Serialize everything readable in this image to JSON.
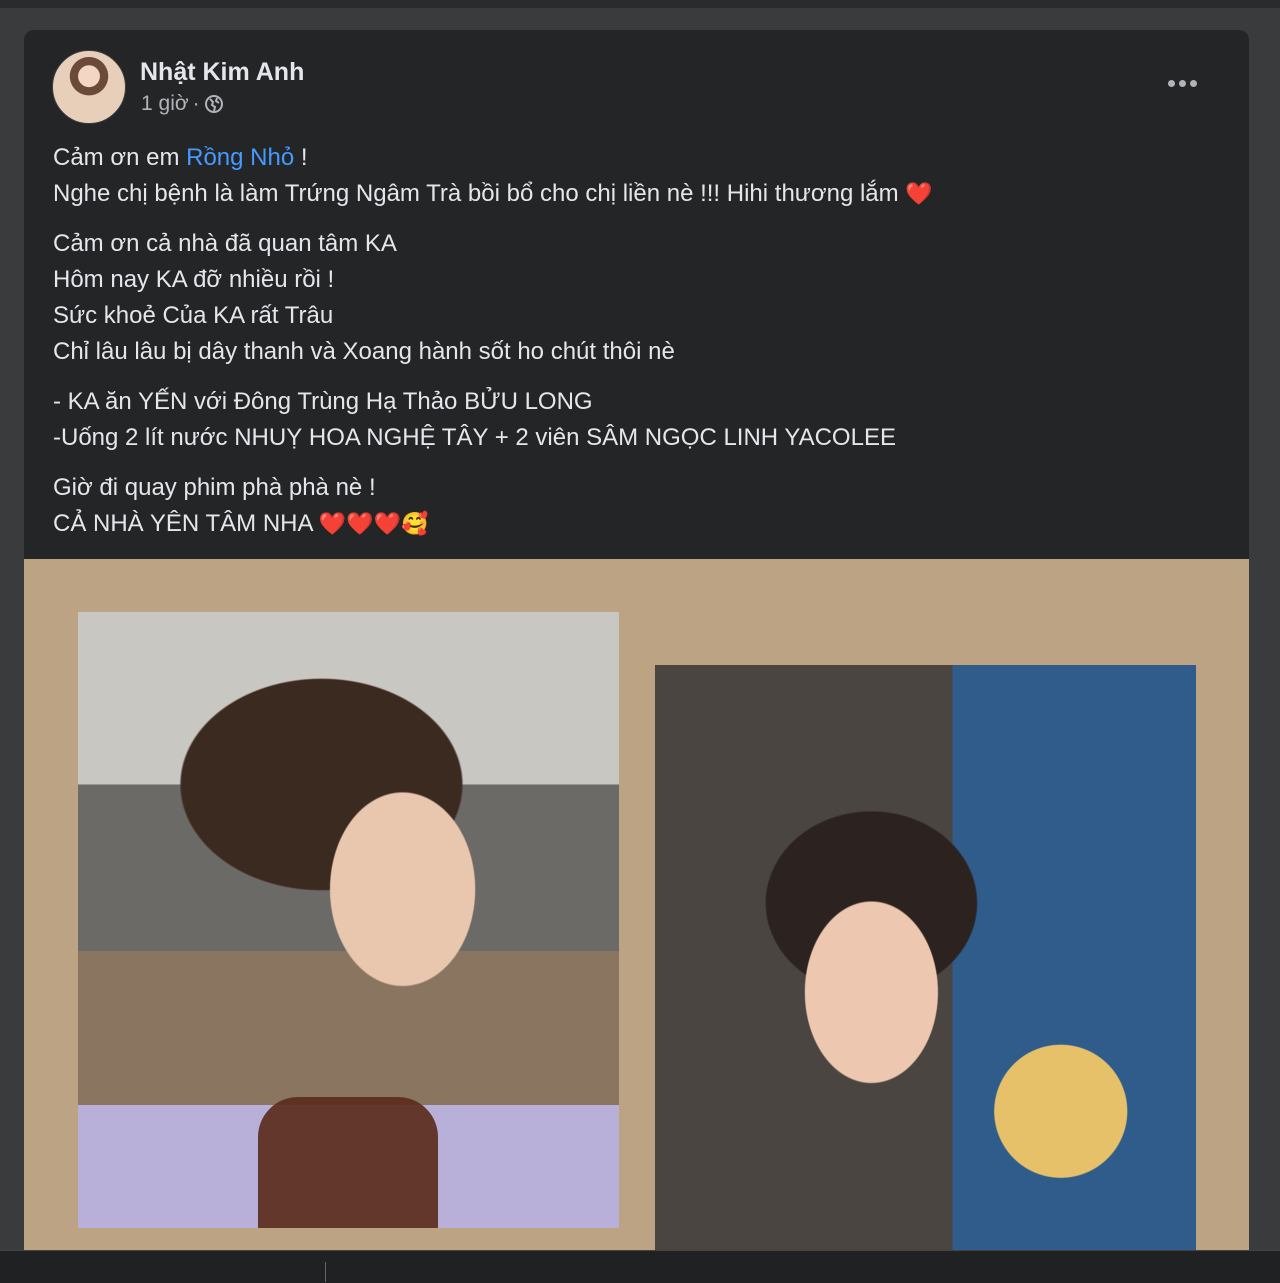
{
  "post": {
    "author": "Nhật Kim Anh",
    "time": "1 giờ",
    "separator": "·",
    "privacy_icon": "globe-icon",
    "more_icon": "more-dots-icon",
    "paragraphs": [
      {
        "lines": [
          {
            "before": "Cảm ơn em ",
            "mention": "Rồng Nhỏ",
            "after": " !"
          },
          {
            "before": "Nghe chị bệnh là làm Trứng Ngâm Trà bồi bổ cho chị liền nè  !!! Hihi thương lắm ",
            "emoji": "❤️"
          }
        ]
      },
      {
        "lines": [
          {
            "before": "Cảm ơn cả nhà đã quan tâm KA"
          },
          {
            "before": "Hôm nay KA đỡ nhiều rồi !"
          },
          {
            "before": "Sức khoẻ Của KA rất Trâu"
          },
          {
            "before": "Chỉ lâu lâu bị dây thanh và Xoang hành sốt ho chút thôi nè"
          }
        ]
      },
      {
        "lines": [
          {
            "before": "- KA ăn YẾN với Đông Trùng Hạ Thảo BỬU LONG"
          },
          {
            "before": "-Uống 2 lít nước NHUỴ HOA NGHỆ TÂY + 2 viên SÂM NGỌC LINH YACOLEE"
          }
        ]
      },
      {
        "lines": [
          {
            "before": "Giờ đi quay phim phà phà nè !"
          },
          {
            "before": "CẢ NHÀ YÊN TÂM NHA ",
            "emoji": "❤️❤️❤️🥰"
          }
        ]
      }
    ]
  },
  "colors": {
    "card_bg": "#242526",
    "text": "#e4e6eb",
    "secondary_text": "#b0b3b8",
    "mention": "#4599ff",
    "image_background": "#bca383"
  }
}
